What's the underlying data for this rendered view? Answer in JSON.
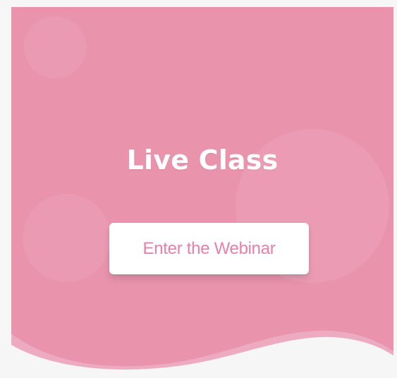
{
  "hero": {
    "title": "Live Class",
    "button_label": "Enter the Webinar"
  },
  "colors": {
    "card_background": "#e993ad",
    "button_text": "#e881a3",
    "button_background": "#ffffff",
    "wave": "#f6f6f6"
  }
}
